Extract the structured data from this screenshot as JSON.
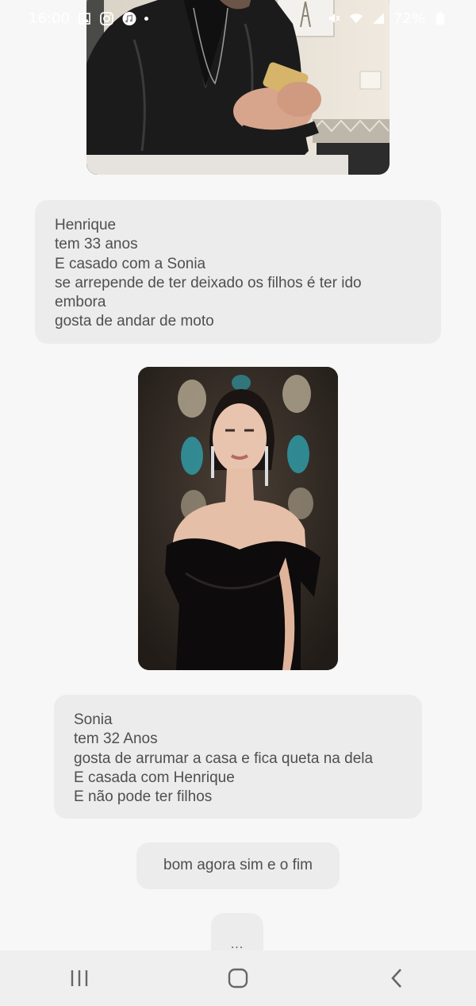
{
  "status_bar": {
    "time": "16:00",
    "battery": "72%",
    "left_icons": [
      "gallery-icon",
      "instagram-icon",
      "music-icon"
    ],
    "right_icons": [
      "mute-icon",
      "wifi-icon",
      "signal-icon",
      "battery-icon"
    ]
  },
  "messages": {
    "photo1": {
      "description_icon": "man-leather-jacket-photo"
    },
    "bubble1": {
      "lines": [
        "Henrique",
        "tem 33 anos",
        "E casado com a Sonia",
        "se arrepende de ter deixado os filhos é ter ido",
        "embora",
        "gosta de andar de moto"
      ]
    },
    "photo2": {
      "description_icon": "woman-black-dress-photo"
    },
    "bubble2": {
      "lines": [
        "Sonia",
        "tem 32 Anos",
        "gosta de arrumar a casa e fica queta na dela",
        "E casada com Henrique",
        "E não pode ter filhos"
      ]
    },
    "bubble3": {
      "text": "bom agora sim e o fim"
    },
    "typing": {
      "text": "..."
    }
  },
  "nav_bar": {
    "buttons": [
      "recent-apps-icon",
      "home-icon",
      "back-icon"
    ]
  },
  "colors": {
    "background": "#f7f7f7",
    "bubble": "#ececec",
    "nav_bar": "#efefef",
    "text": "#4f4f4f"
  }
}
